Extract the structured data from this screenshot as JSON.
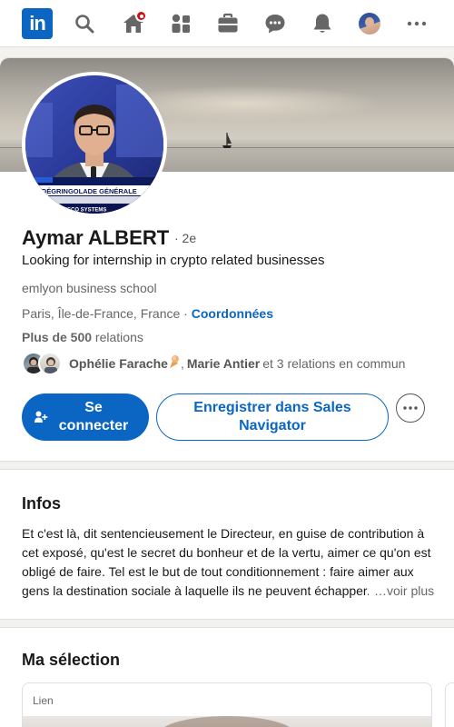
{
  "nav": {
    "logo_text": "in",
    "items": [
      "search-icon",
      "home-icon",
      "network-icon",
      "jobs-icon",
      "messaging-icon",
      "notifications-icon",
      "me-avatar",
      "more-icon"
    ]
  },
  "profile": {
    "name": "Aymar ALBERT",
    "degree": "· 2e",
    "headline": "Looking for internship in crypto related businesses",
    "school": "emlyon business school",
    "location": "Paris, Île-de-France, France",
    "location_separator": " · ",
    "contact_link": "Coordonnées",
    "relations_count": "Plus de 500",
    "relations_label": " relations",
    "mutual": {
      "name1": "Ophélie Farache",
      "separator": ", ",
      "name2": "Marie Antier",
      "rest": "et 3 relations en commun"
    },
    "connect_button": "Se connecter",
    "sales_button": "Enregistrer dans Sales Navigator",
    "avatar_banner": "LA DÉGRINGOLADE GÉNÉRALE",
    "avatar_banner_small": "CISCO SYSTEMS"
  },
  "infos": {
    "title": "Infos",
    "text": "Et c'est là, dit sentencieusement le Directeur, en guise de contribution à cet exposé, qu'est le secret du bonheur et de la vertu, aimer ce qu'on est obligé de faire. Tel est le but de tout conditionnement : faire aimer aux gens la destination sociale à laquelle ils ne peuvent échapper.",
    "more": "…voir plus"
  },
  "selection": {
    "title": "Ma sélection",
    "item_tag": "Lien"
  },
  "colors": {
    "brand": "#0a66c2",
    "notification_badge": "#cc1016",
    "background": "#f3f2ef"
  }
}
